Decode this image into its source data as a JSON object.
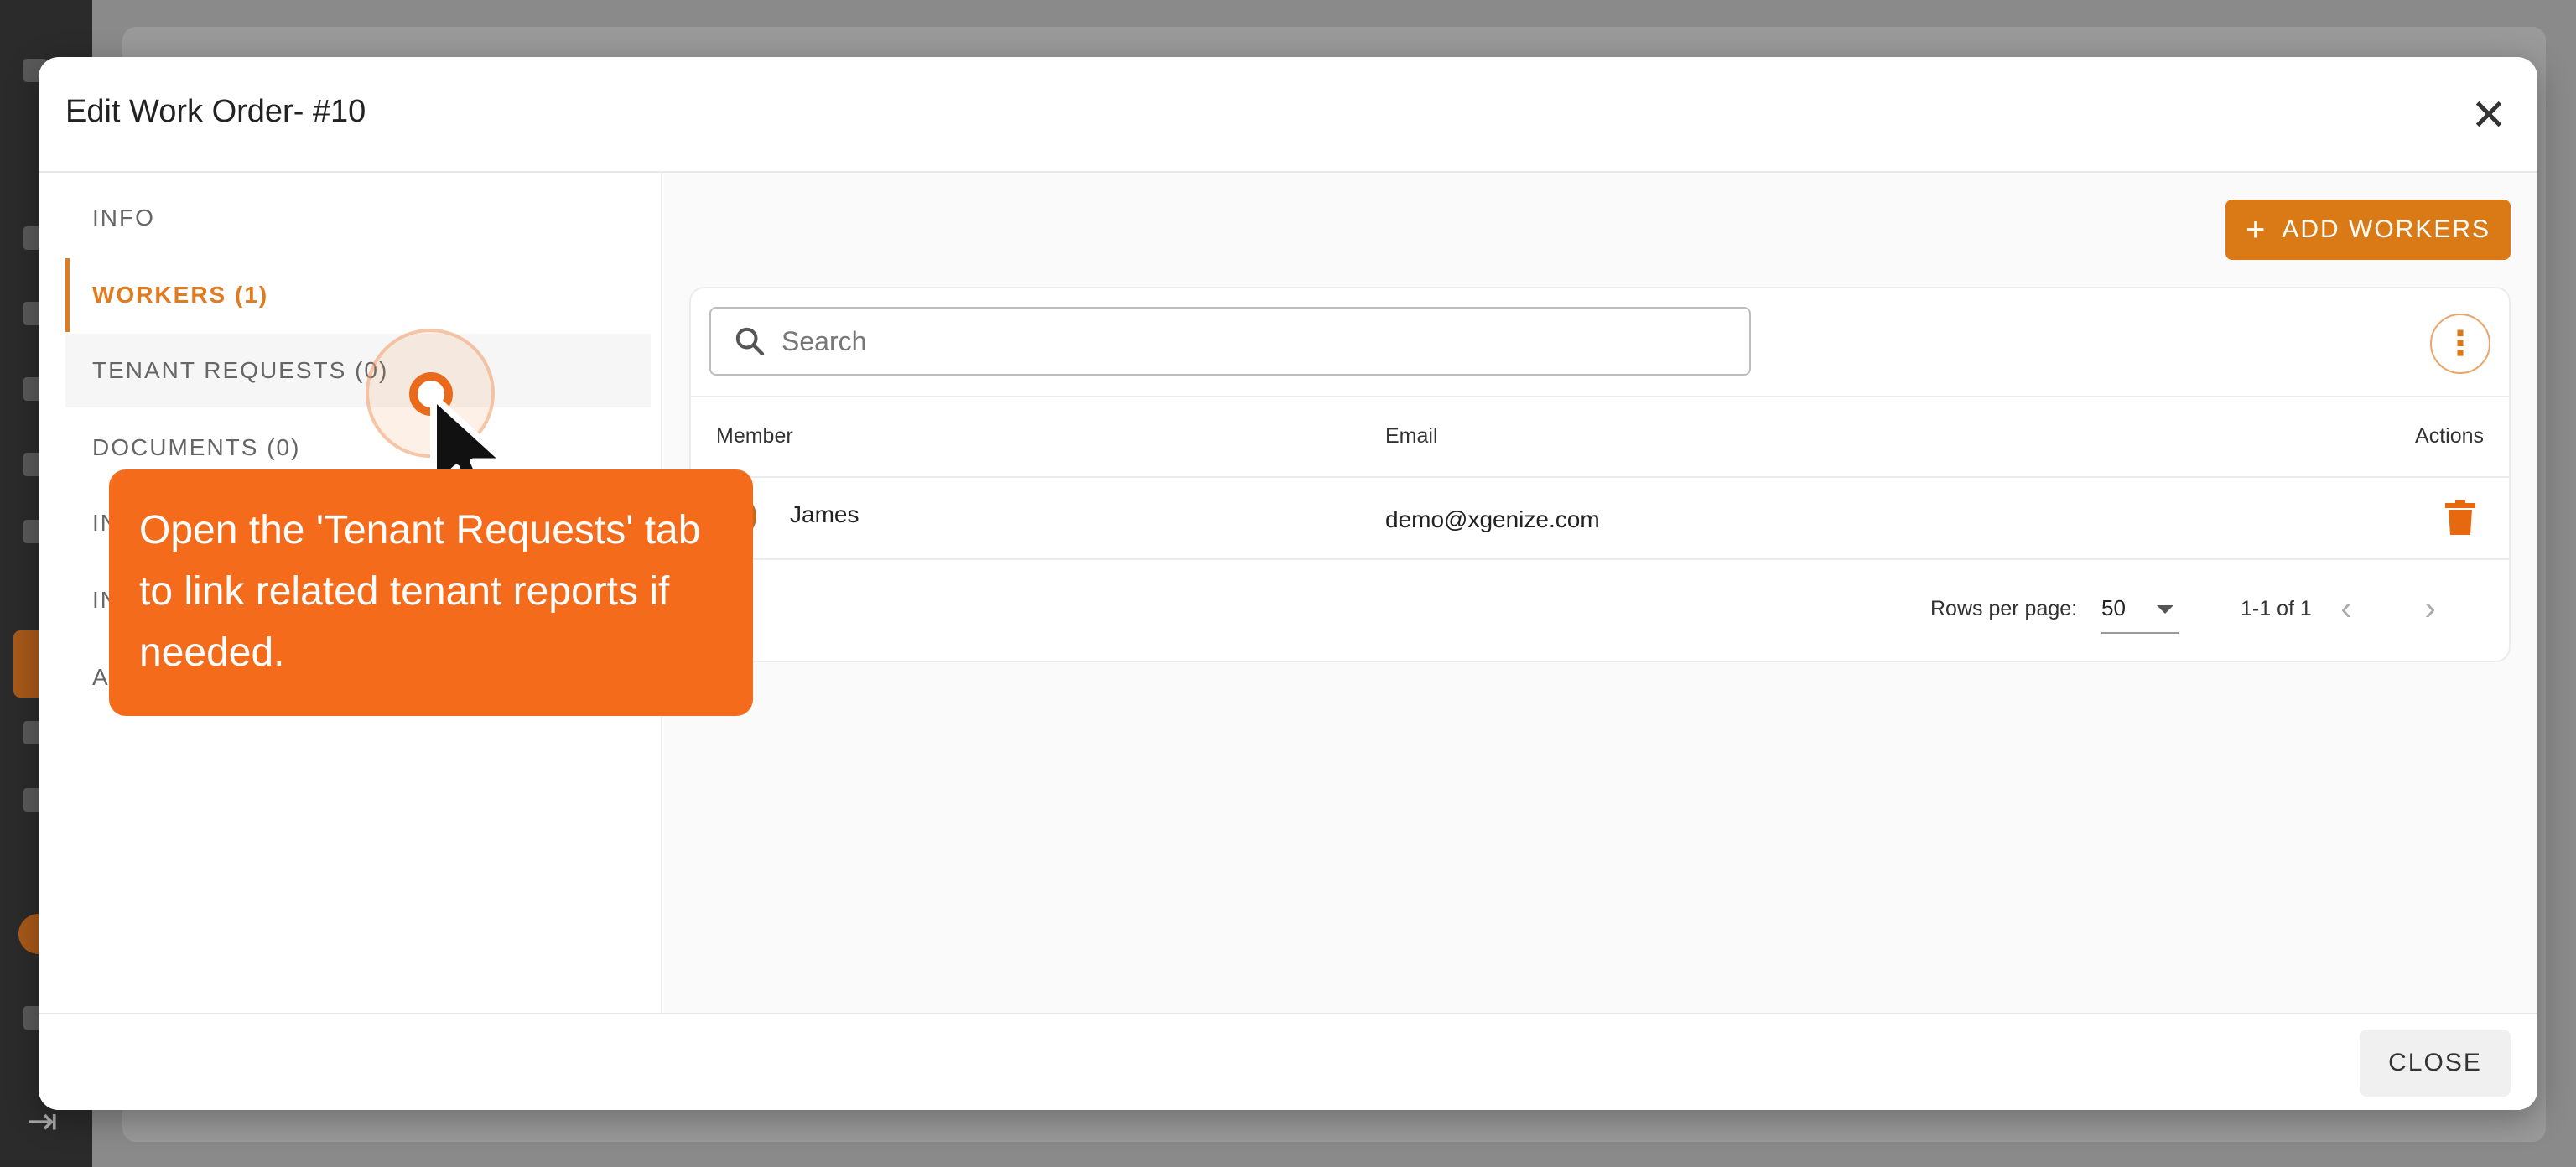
{
  "modal": {
    "title": "Edit Work Order- #10",
    "close_icon": "close-icon"
  },
  "nav": {
    "items": [
      {
        "label": "INFO",
        "state": "default"
      },
      {
        "label": "WORKERS (1)",
        "state": "active"
      },
      {
        "label": "TENANT REQUESTS (0)",
        "state": "hover"
      },
      {
        "label": "DOCUMENTS (0)",
        "state": "default"
      },
      {
        "label": "IN",
        "state": "default"
      },
      {
        "label": "IN",
        "state": "default"
      },
      {
        "label": "A",
        "state": "default"
      }
    ]
  },
  "toolbar": {
    "add_workers_label": "ADD WORKERS"
  },
  "search": {
    "placeholder": "Search",
    "value": ""
  },
  "table": {
    "columns": [
      "Member",
      "Email",
      "Actions"
    ],
    "rows": [
      {
        "member": "James",
        "email": "demo@xgenize.com"
      }
    ]
  },
  "pagination": {
    "rows_per_page_label": "Rows per page:",
    "rows_per_page": "50",
    "range": "1-1 of 1"
  },
  "footer": {
    "close_label": "CLOSE"
  },
  "tutorial": {
    "tooltip_text": "Open the 'Tenant Requests' tab to link related tenant reports if needed."
  },
  "colors": {
    "accent": "#d97a16",
    "tooltip": "#f46b1c",
    "active_nav": "#e07b1f"
  }
}
